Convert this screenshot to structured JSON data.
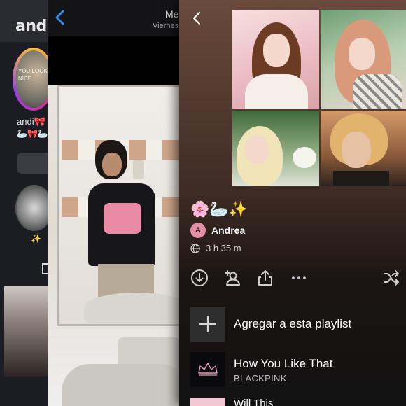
{
  "background_app": {
    "username": "andi",
    "avatar_text": "YOU LOOK NICE",
    "display_name": "andi🎀",
    "bio_emojis": "🦢🎀🦢",
    "highlight_caption": "✨"
  },
  "messages_app": {
    "title": "Me",
    "subtitle": "Viernes"
  },
  "playlist": {
    "title": "🌸🦢✨",
    "owner_initial": "A",
    "owner": "Andrea",
    "duration": "3 h 35 m",
    "actions": [
      "download-icon",
      "add-collaborator-icon",
      "share-icon",
      "more-icon",
      "shuffle-icon"
    ],
    "add_to_playlist_label": "Agregar a esta playlist",
    "tracks": [
      {
        "title": "How You Like That",
        "artist": "BLACKPINK"
      },
      {
        "title": "Will This"
      }
    ],
    "colors": {
      "header_top": "#6a4a3c",
      "background": "#121212",
      "owner_avatar": "#e58fa6"
    }
  }
}
